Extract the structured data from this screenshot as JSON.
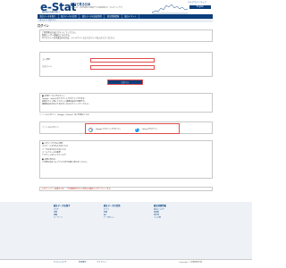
{
  "header": {
    "logo": "e-Stat",
    "logo_sub": "政府統計の総合窓口",
    "tagline": "統計で見る日本",
    "tagline_sub": "e-Statは、日本の統計が閲覧できる政府統計ポータルサイトです",
    "links": "ヘルプ  サイトマップ",
    "lang": "English"
  },
  "nav": [
    "統計データを探す",
    "統計データの活用",
    "統計データの高度利用",
    "統計関連情報",
    "統計イベント"
  ],
  "breadcrumb": "ホーム > ログイン",
  "page_title": "ログイン",
  "notice": [
    "ご利用者の方はログインしてください。",
    "新規ユーザー登録はこちらから。",
    "※アカウントを作成済みの方は、メールアドレスとパスワードを入力してください。"
  ],
  "form": {
    "user_label": "ユーザID",
    "password_label": "パスワード",
    "login_button": "ログイン"
  },
  "info": [
    "■ 外部サービスでログイン",
    "Google、Twitterのアカウントでログインできます。",
    "初回ログイン時にアカウント連携の設定が必要です。",
    "連携済みの方は以下のボタンからログインしてください。"
  ],
  "social_note": "ソーシャルログイン（Google / Twitter）のご利用はこちら",
  "social": {
    "label": "ソーシャルログイン",
    "google": "Googleアカウントでログイン",
    "twitter": "Twitterでログイン"
  },
  "help": [
    "■ ログインできない場合",
    "パスワードを忘れた方はこちら",
    "ユーザIDを忘れた方はこちら",
    "メールアドレスの変更",
    "アカウントのロックについて",
    "■ お問い合わせ",
    "ご不明な点はヘルプデスクまでお問い合わせください。"
  ],
  "warning": "※セキュリティ保護のため、一定時間操作がない場合は自動的にログアウトします。",
  "footer": {
    "col1": {
      "heading": "統計データを探す",
      "links": [
        "すべて",
        "分野",
        "組織",
        "キーワード"
      ]
    },
    "col2": {
      "heading": "統計データの活用",
      "links": [
        "グラフ",
        "地図",
        "API",
        "データセット"
      ]
    },
    "col3": {
      "heading": "統計関連情報",
      "links": [
        "統計について",
        "用語集",
        "統計表",
        "リンク集"
      ]
    }
  },
  "bottom": {
    "links": [
      "サイトについて",
      "利用規約",
      "プライバシー"
    ],
    "copyright": "Copyright © 総務省統計局"
  },
  "colors": {
    "primary": "#0b3f7c",
    "highlight": "#e24b4b"
  }
}
